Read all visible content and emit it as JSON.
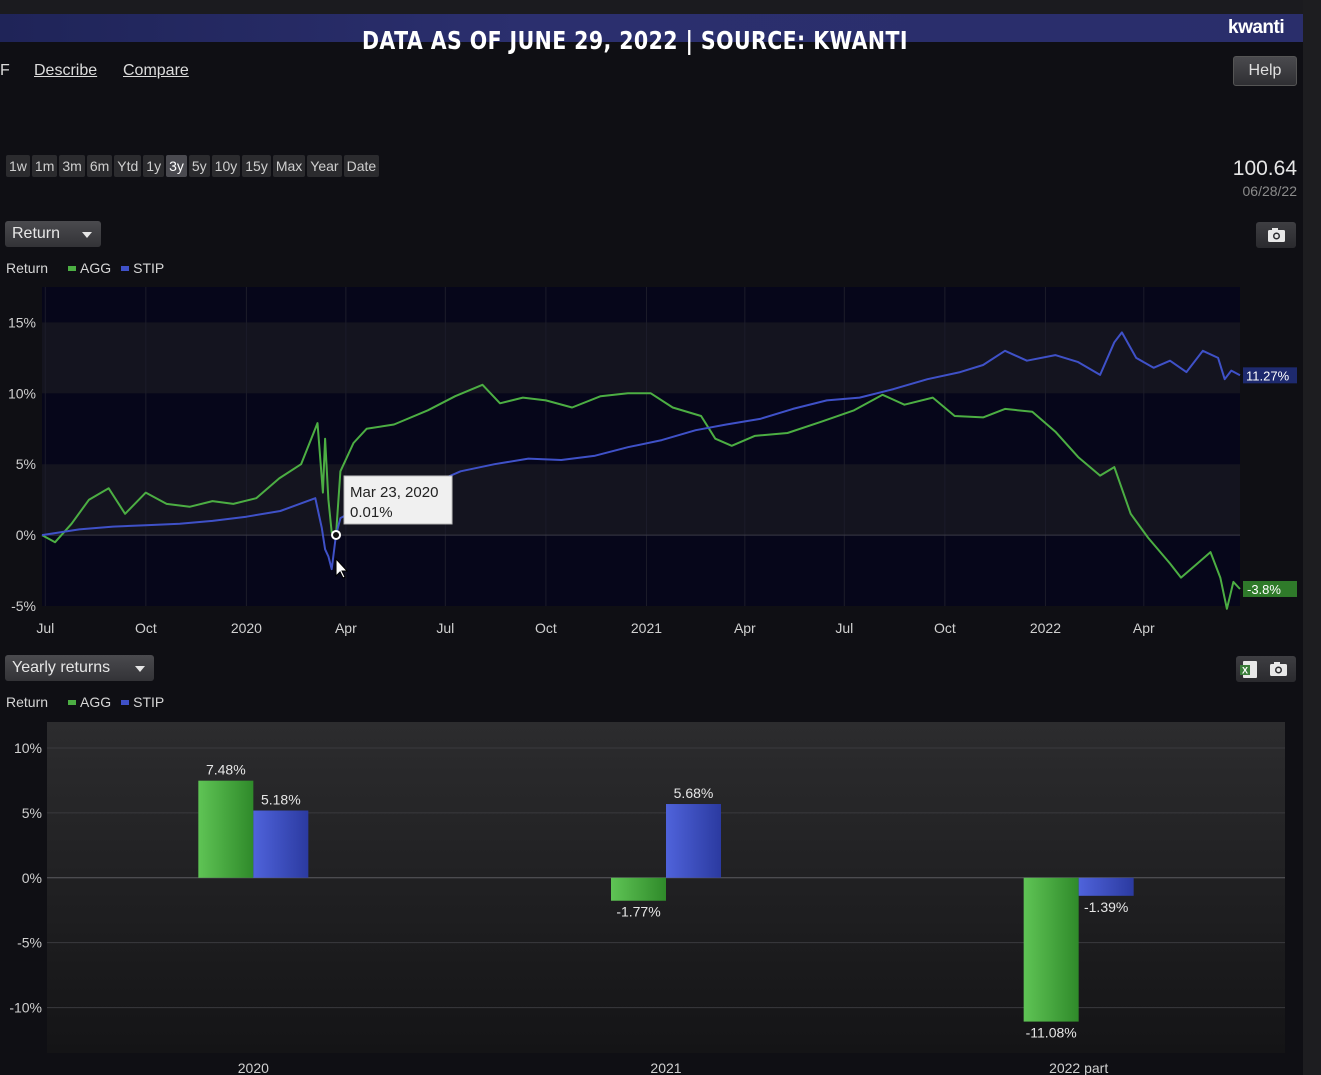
{
  "banner": {
    "text": "DATA AS OF JUNE 29, 2022  |  SOURCE: KWANTI",
    "logo": "kwanti"
  },
  "nav": {
    "partial": "F",
    "describe": "Describe",
    "compare": "Compare",
    "help": "Help"
  },
  "ranges": {
    "items": [
      "1w",
      "1m",
      "3m",
      "6m",
      "Ytd",
      "1y",
      "3y",
      "5y",
      "10y",
      "15y",
      "Max",
      "Year",
      "Date"
    ],
    "active": "3y"
  },
  "price": {
    "value": "100.64",
    "date": "06/28/22"
  },
  "line_section": {
    "dropdown": "Return",
    "legend_title": "Return",
    "legend": [
      {
        "name": "AGG",
        "color": "#4cae43"
      },
      {
        "name": "STIP",
        "color": "#3f51c8"
      }
    ],
    "tooltip": {
      "date": "Mar 23, 2020",
      "value": "0.01%"
    },
    "end_labels": {
      "stip": "11.27%",
      "agg": "-3.8%"
    },
    "camera_icon": "camera-icon"
  },
  "bar_section": {
    "dropdown": "Yearly returns",
    "legend_title": "Return",
    "legend": [
      {
        "name": "AGG",
        "color": "#4cae43"
      },
      {
        "name": "STIP",
        "color": "#3f51c8"
      }
    ],
    "excel_icon": "excel-icon",
    "camera_icon": "camera-icon"
  },
  "chart_data": [
    {
      "type": "line",
      "ylabel": "Return",
      "ylim": [
        -5,
        17.5
      ],
      "yticks": [
        -5,
        0,
        5,
        10,
        15
      ],
      "ytick_labels": [
        "-5%",
        "0%",
        "5%",
        "10%",
        "15%"
      ],
      "x_range": [
        "2019-06-28",
        "2022-06-28"
      ],
      "xticks": [
        {
          "date": "2019-07-01",
          "label": "Jul"
        },
        {
          "date": "2019-10-01",
          "label": "Oct"
        },
        {
          "date": "2020-01-01",
          "label": "2020"
        },
        {
          "date": "2020-04-01",
          "label": "Apr"
        },
        {
          "date": "2020-07-01",
          "label": "Jul"
        },
        {
          "date": "2020-10-01",
          "label": "Oct"
        },
        {
          "date": "2021-01-01",
          "label": "2021"
        },
        {
          "date": "2021-04-01",
          "label": "Apr"
        },
        {
          "date": "2021-07-01",
          "label": "Jul"
        },
        {
          "date": "2021-10-01",
          "label": "Oct"
        },
        {
          "date": "2022-01-01",
          "label": "2022"
        },
        {
          "date": "2022-04-01",
          "label": "Apr"
        }
      ],
      "grid": true,
      "legend": "top-left",
      "series": [
        {
          "name": "AGG",
          "color": "#4cae43",
          "points": [
            [
              "2019-06-28",
              0.0
            ],
            [
              "2019-07-10",
              -0.5
            ],
            [
              "2019-07-25",
              0.8
            ],
            [
              "2019-08-10",
              2.5
            ],
            [
              "2019-08-28",
              3.3
            ],
            [
              "2019-09-12",
              1.5
            ],
            [
              "2019-10-01",
              3.0
            ],
            [
              "2019-10-20",
              2.2
            ],
            [
              "2019-11-10",
              2.0
            ],
            [
              "2019-12-01",
              2.4
            ],
            [
              "2019-12-20",
              2.2
            ],
            [
              "2020-01-10",
              2.6
            ],
            [
              "2020-01-31",
              4.0
            ],
            [
              "2020-02-20",
              5.0
            ],
            [
              "2020-03-06",
              7.9
            ],
            [
              "2020-03-11",
              3.0
            ],
            [
              "2020-03-13",
              6.8
            ],
            [
              "2020-03-16",
              2.5
            ],
            [
              "2020-03-19",
              0.2
            ],
            [
              "2020-03-23",
              0.01
            ],
            [
              "2020-03-27",
              4.5
            ],
            [
              "2020-04-08",
              6.5
            ],
            [
              "2020-04-20",
              7.5
            ],
            [
              "2020-05-15",
              7.8
            ],
            [
              "2020-06-15",
              8.8
            ],
            [
              "2020-07-10",
              9.8
            ],
            [
              "2020-08-04",
              10.6
            ],
            [
              "2020-08-20",
              9.3
            ],
            [
              "2020-09-10",
              9.7
            ],
            [
              "2020-10-01",
              9.5
            ],
            [
              "2020-10-25",
              9.0
            ],
            [
              "2020-11-20",
              9.8
            ],
            [
              "2020-12-15",
              10.0
            ],
            [
              "2021-01-05",
              10.0
            ],
            [
              "2021-01-25",
              9.0
            ],
            [
              "2021-02-20",
              8.4
            ],
            [
              "2021-03-05",
              6.8
            ],
            [
              "2021-03-20",
              6.3
            ],
            [
              "2021-04-10",
              7.0
            ],
            [
              "2021-05-10",
              7.2
            ],
            [
              "2021-06-10",
              8.0
            ],
            [
              "2021-07-10",
              8.8
            ],
            [
              "2021-08-05",
              9.9
            ],
            [
              "2021-08-25",
              9.2
            ],
            [
              "2021-09-20",
              9.7
            ],
            [
              "2021-10-10",
              8.4
            ],
            [
              "2021-11-05",
              8.3
            ],
            [
              "2021-11-25",
              8.9
            ],
            [
              "2021-12-20",
              8.7
            ],
            [
              "2022-01-10",
              7.3
            ],
            [
              "2022-01-31",
              5.5
            ],
            [
              "2022-02-20",
              4.2
            ],
            [
              "2022-03-05",
              4.8
            ],
            [
              "2022-03-20",
              1.5
            ],
            [
              "2022-04-05",
              -0.2
            ],
            [
              "2022-04-25",
              -2.0
            ],
            [
              "2022-05-05",
              -3.0
            ],
            [
              "2022-05-20",
              -2.0
            ],
            [
              "2022-06-01",
              -1.2
            ],
            [
              "2022-06-10",
              -3.0
            ],
            [
              "2022-06-16",
              -5.2
            ],
            [
              "2022-06-22",
              -3.3
            ],
            [
              "2022-06-28",
              -3.8
            ]
          ],
          "end_label": "-3.8%"
        },
        {
          "name": "STIP",
          "color": "#3f51c8",
          "points": [
            [
              "2019-06-28",
              0.0
            ],
            [
              "2019-08-01",
              0.4
            ],
            [
              "2019-09-01",
              0.6
            ],
            [
              "2019-10-01",
              0.7
            ],
            [
              "2019-11-01",
              0.8
            ],
            [
              "2019-12-01",
              1.0
            ],
            [
              "2020-01-01",
              1.3
            ],
            [
              "2020-02-01",
              1.7
            ],
            [
              "2020-03-04",
              2.6
            ],
            [
              "2020-03-10",
              0.5
            ],
            [
              "2020-03-13",
              -1.0
            ],
            [
              "2020-03-16",
              -1.5
            ],
            [
              "2020-03-19",
              -2.4
            ],
            [
              "2020-03-23",
              0.01
            ],
            [
              "2020-03-27",
              1.2
            ],
            [
              "2020-04-15",
              2.0
            ],
            [
              "2020-05-15",
              2.8
            ],
            [
              "2020-06-15",
              3.5
            ],
            [
              "2020-07-15",
              4.5
            ],
            [
              "2020-08-15",
              5.0
            ],
            [
              "2020-09-15",
              5.4
            ],
            [
              "2020-10-15",
              5.3
            ],
            [
              "2020-11-15",
              5.6
            ],
            [
              "2020-12-15",
              6.2
            ],
            [
              "2021-01-15",
              6.7
            ],
            [
              "2021-02-15",
              7.4
            ],
            [
              "2021-03-15",
              7.8
            ],
            [
              "2021-04-15",
              8.2
            ],
            [
              "2021-05-15",
              8.9
            ],
            [
              "2021-06-15",
              9.5
            ],
            [
              "2021-07-15",
              9.7
            ],
            [
              "2021-08-15",
              10.3
            ],
            [
              "2021-09-15",
              11.0
            ],
            [
              "2021-10-15",
              11.5
            ],
            [
              "2021-11-05",
              12.0
            ],
            [
              "2021-11-25",
              13.0
            ],
            [
              "2021-12-15",
              12.3
            ],
            [
              "2022-01-10",
              12.7
            ],
            [
              "2022-01-31",
              12.2
            ],
            [
              "2022-02-20",
              11.3
            ],
            [
              "2022-03-05",
              13.6
            ],
            [
              "2022-03-12",
              14.3
            ],
            [
              "2022-03-25",
              12.5
            ],
            [
              "2022-04-10",
              11.8
            ],
            [
              "2022-04-25",
              12.3
            ],
            [
              "2022-05-10",
              11.5
            ],
            [
              "2022-05-25",
              13.0
            ],
            [
              "2022-06-08",
              12.5
            ],
            [
              "2022-06-14",
              11.0
            ],
            [
              "2022-06-20",
              11.6
            ],
            [
              "2022-06-28",
              11.27
            ]
          ],
          "end_label": "11.27%"
        }
      ],
      "annotations": [
        {
          "date": "Mar 23, 2020",
          "value": "0.01%"
        }
      ]
    },
    {
      "type": "bar",
      "title": "Yearly returns",
      "ylabel": "Return",
      "categories": [
        "2020",
        "2021",
        "2022 part"
      ],
      "ylim": [
        -13.5,
        12
      ],
      "yticks": [
        -10,
        -5,
        0,
        5,
        10
      ],
      "ytick_labels": [
        "-10%",
        "-5%",
        "0%",
        "5%",
        "10%"
      ],
      "grid": true,
      "legend": "top-left",
      "series": [
        {
          "name": "AGG",
          "color": "#4cae43",
          "values": [
            7.48,
            -1.77,
            -11.08
          ],
          "labels": [
            "7.48%",
            "-1.77%",
            "-11.08%"
          ]
        },
        {
          "name": "STIP",
          "color": "#3f51c8",
          "values": [
            5.18,
            5.68,
            -1.39
          ],
          "labels": [
            "5.18%",
            "5.68%",
            "-1.39%"
          ]
        }
      ]
    }
  ]
}
